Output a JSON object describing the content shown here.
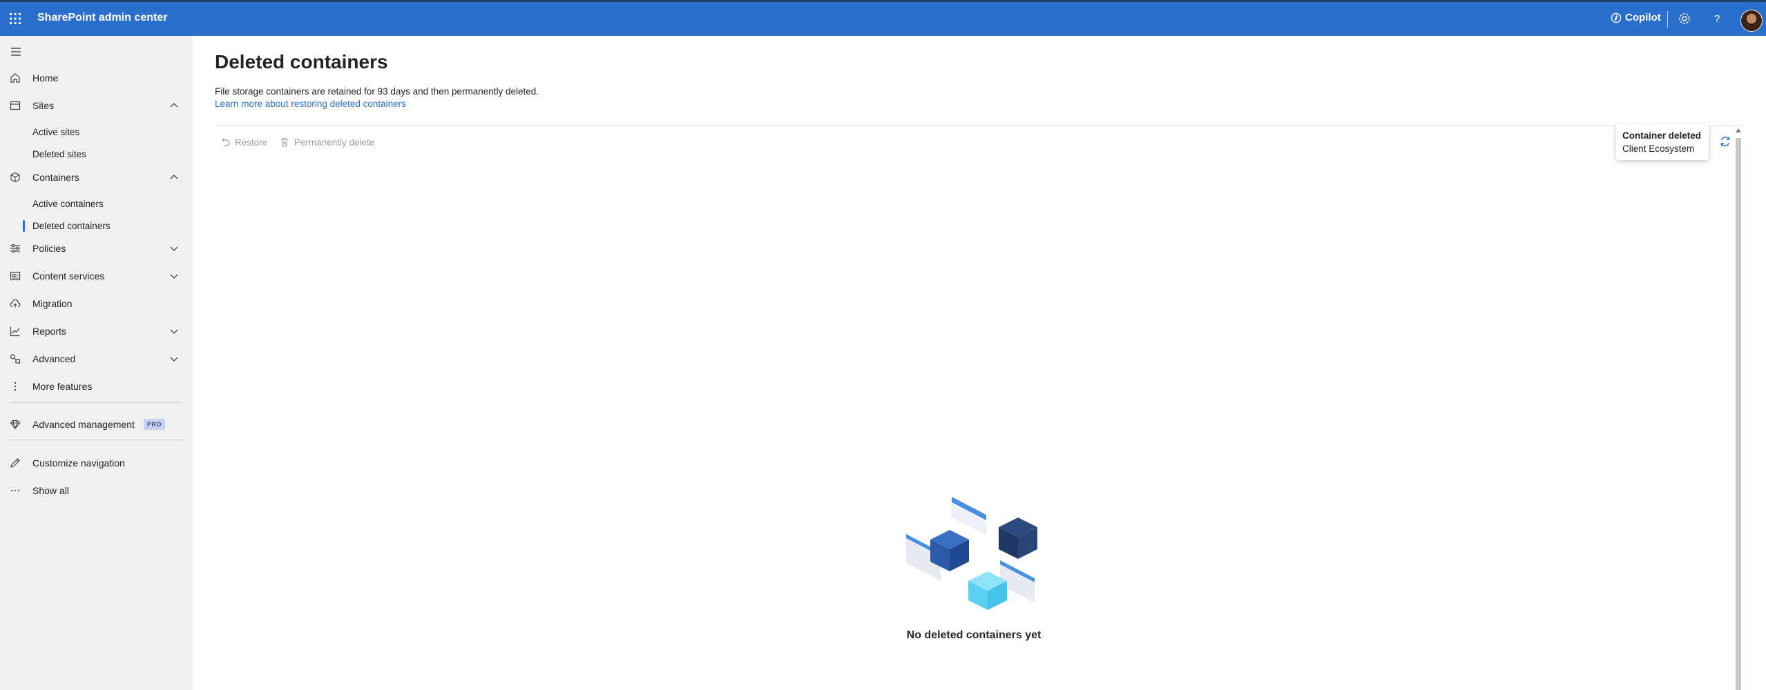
{
  "app": {
    "title": "SharePoint admin center",
    "copilot_label": "Copilot"
  },
  "sidebar": {
    "items": [
      {
        "label": "Home",
        "icon": "home-icon"
      },
      {
        "label": "Sites",
        "icon": "sites-icon",
        "expanded": true
      },
      {
        "label": "Containers",
        "icon": "containers-icon",
        "expanded": true
      },
      {
        "label": "Policies",
        "icon": "policies-icon",
        "expanded": false
      },
      {
        "label": "Content services",
        "icon": "content-services-icon",
        "expanded": false
      },
      {
        "label": "Migration",
        "icon": "migration-icon"
      },
      {
        "label": "Reports",
        "icon": "reports-icon",
        "expanded": false
      },
      {
        "label": "Advanced",
        "icon": "advanced-icon",
        "expanded": false
      },
      {
        "label": "More features",
        "icon": "more-vertical-icon"
      },
      {
        "label": "Advanced management",
        "icon": "diamond-icon",
        "badge": "PRO"
      },
      {
        "label": "Customize navigation",
        "icon": "pencil-icon"
      },
      {
        "label": "Show all",
        "icon": "more-horizontal-icon"
      }
    ],
    "sites_children": [
      "Active sites",
      "Deleted sites"
    ],
    "containers_children": [
      "Active containers",
      "Deleted containers"
    ],
    "selected": "Deleted containers"
  },
  "main": {
    "title": "Deleted containers",
    "description": "File storage containers are retained for 93 days and then permanently deleted.",
    "learn_more": "Learn more about restoring deleted containers",
    "commands": {
      "restore": "Restore",
      "permanently_delete": "Permanently delete"
    },
    "empty_state": "No deleted containers yet"
  },
  "toast": {
    "title": "Container deleted",
    "subtitle": "Client Ecosystem"
  },
  "colors": {
    "accent": "#2b6fcc",
    "sidebar_bg": "#f0f0f0",
    "disabled_text": "#a19f9d"
  }
}
